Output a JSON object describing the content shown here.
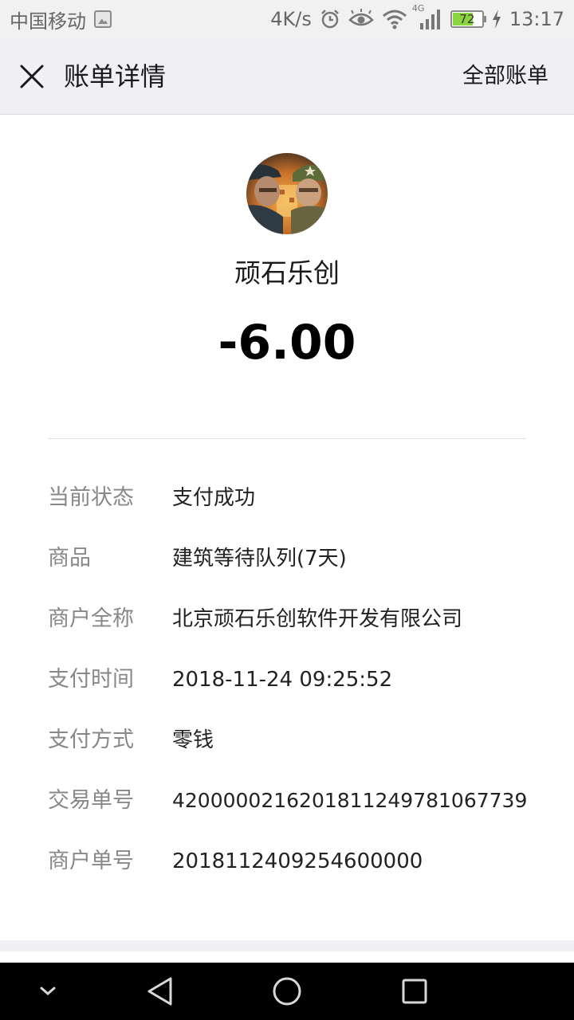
{
  "status_bar": {
    "carrier": "中国移动",
    "speed": "4K/s",
    "network": "4G",
    "battery": "72",
    "battery_level": 0.72,
    "time": "13:17"
  },
  "header": {
    "title": "账单详情",
    "right_link": "全部账单"
  },
  "merchant": {
    "name": "顽石乐创",
    "amount": "-6.00"
  },
  "details": [
    {
      "label": "当前状态",
      "value": "支付成功"
    },
    {
      "label": "商品",
      "value": "建筑等待队列(7天)"
    },
    {
      "label": "商户全称",
      "value": "北京顽石乐创软件开发有限公司"
    },
    {
      "label": "支付时间",
      "value": "2018-11-24 09:25:52"
    },
    {
      "label": "支付方式",
      "value": "零钱"
    },
    {
      "label": "交易单号",
      "value": "4200000216201811249781067739"
    },
    {
      "label": "商户单号",
      "value": "2018112409254600000"
    }
  ],
  "icons": {
    "close": "close-icon",
    "back": "back-triangle-icon",
    "home": "home-circle-icon",
    "recents": "recents-square-icon",
    "collapse": "chevron-down-icon"
  },
  "colors": {
    "header_bg": "#efeff4",
    "label_text": "#888888",
    "value_text": "#222222",
    "battery_fill": "#8cd43c"
  }
}
